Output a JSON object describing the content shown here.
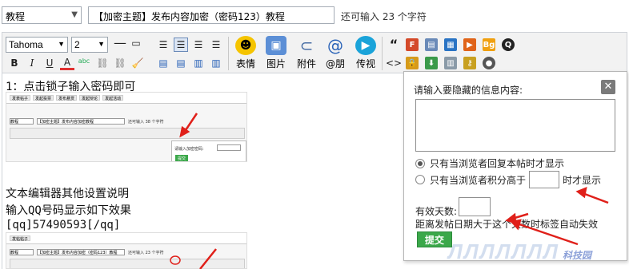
{
  "top": {
    "category_value": "教程",
    "title_value": "【加密主题】发布内容加密（密码123）教程",
    "remaining_text": "还可输入 23 个字符"
  },
  "toolbar": {
    "font_value": "Tahoma",
    "size_value": "2",
    "bold": "B",
    "italic": "I",
    "underline": "U",
    "font_color": "A",
    "spell": "abc",
    "big_buttons": [
      "表情",
      "图片",
      "附件",
      "@朋",
      "传视"
    ],
    "quote_glyph": "“",
    "code_glyph": "<>"
  },
  "editor": {
    "line1": "1：点击锁子输入密码即可",
    "line2": "文本编辑器其他设置说明",
    "line3": "输入QQ号码显示如下效果",
    "line4": "[qq]57490593[/qq]"
  },
  "mini": {
    "tabs": [
      "发表帖子",
      "发起投票",
      "发布悬赏",
      "发起辩论",
      "发起活动"
    ],
    "category": "教程",
    "title": "【加密主题】发布内容加密教程",
    "remaining": "还可输入 38 个字符",
    "popup_label": "请输入加密密码:",
    "submit": "提交",
    "tabs2": [
      "发帖帖子"
    ],
    "category2": "教程",
    "title2": "【加密主题】发布内容加密（密码123）教程",
    "remaining2": "还可输入 23 个字符"
  },
  "dialog": {
    "title": "请输入要隐藏的信息内容:",
    "close": "✕",
    "option1": "只有当浏览者回复本帖时才显示",
    "option2_pre": "只有当浏览者积分高于",
    "option2_post": "时才显示",
    "days_label": "有效天数:",
    "hint": "距离发帖日期大于这个天数时标签自动失效",
    "submit": "提交"
  },
  "watermark": {
    "text": "ЛЛЛЛЛЛЛ",
    "site": "科技园"
  }
}
